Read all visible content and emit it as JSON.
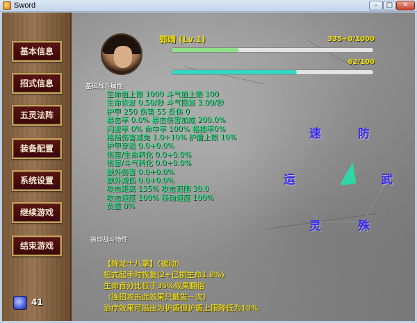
{
  "window": {
    "title": "Sword",
    "minimize": "–",
    "maximize": "□",
    "close": "✕"
  },
  "sidebar": {
    "items": [
      {
        "label": "基本信息"
      },
      {
        "label": "招式信息"
      },
      {
        "label": "五灵法阵"
      },
      {
        "label": "装备配置"
      },
      {
        "label": "系统设置"
      },
      {
        "label": "继续游戏"
      },
      {
        "label": "结束游戏"
      }
    ],
    "currency": {
      "icon": "crystal-icon",
      "value": "41"
    }
  },
  "character": {
    "name": "郭靖 (Lv.1)",
    "exp_text": "335+0/1000",
    "exp_ratio": 0.335,
    "hp_text": "62/100",
    "hp_ratio": 0.62,
    "exp_color": "#8fe08a",
    "hp_color": "#33d7c1"
  },
  "basic_stats": {
    "title": "基础战斗属性",
    "lines": [
      "生命值上限 1000 斗气值上限 100",
      "生命恢复 0.50/秒  斗气回复 3.00/秒",
      "护甲 250  伤害 55  反伤 0",
      "暴击率 0.0%   暴击伤害加成 200.0%",
      "闪避率 0%   命中率 100%   格挡率0%",
      "格挡伤害减免 1.0+10%   护盾上限 10%",
      "护甲穿透 0.0+0.0%",
      "伤害/生命转化 0.0+0.0%",
      "伤害/斗气转化 0.0+0.0%",
      "额外伤害 0.0+0.0%",
      "额外减伤 0.0+0.0%",
      "攻击距离 135%      攻击范围 30.0",
      "攻击速度 100%   移动速度 100%",
      "负重 0%"
    ]
  },
  "passive": {
    "title": "被动战斗特性",
    "lines": [
      "【降龙十八掌】（被动）",
      "招式起手时恢复(2+已损生命1.8%)",
      "生命百分比低于35%效果翻倍",
      "（连招攻击此效果只触发一次）",
      "治疗效果可溢出为护盾但护盾上限降低为10%"
    ]
  },
  "radar": {
    "labels": [
      "速",
      "防",
      "武",
      "殊",
      "灵",
      "运"
    ],
    "values": [
      0.0,
      0.55,
      0.35,
      0.05,
      0.0,
      0.42
    ],
    "fill_color": "#2fd6a6",
    "label_color": "#3b2cf0"
  }
}
